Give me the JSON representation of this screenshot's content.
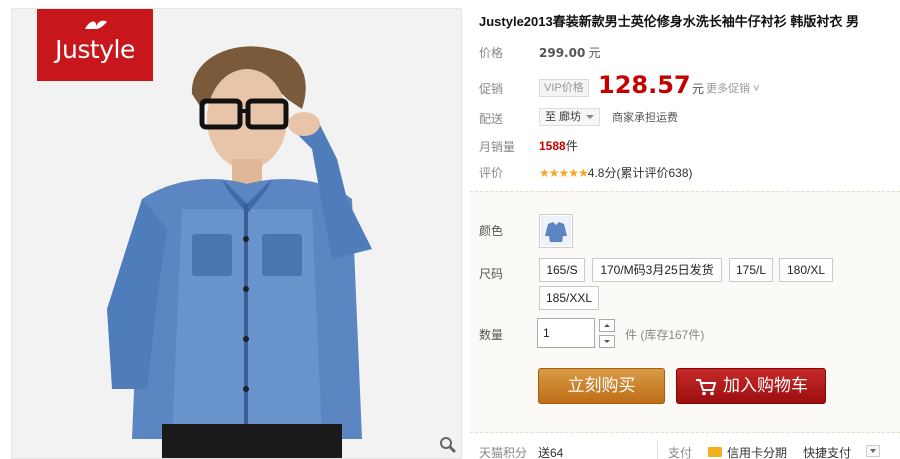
{
  "gallery": {
    "brand_text": "Justyle"
  },
  "product": {
    "title": "Justyle2013春装新款男士英伦修身水洗长袖牛仔衬衫 韩版衬衣 男"
  },
  "price": {
    "label": "价格",
    "original": "299.00",
    "currency": "元"
  },
  "promo": {
    "label": "促销",
    "vip_tag": "VIP价格",
    "price": "128.57",
    "currency": "元",
    "more": "更多促销"
  },
  "delivery": {
    "label": "配送",
    "location": "至 廊坊",
    "shipping": "商家承担运费"
  },
  "sales": {
    "label": "月销量",
    "count": "1588",
    "unit": "件"
  },
  "rating": {
    "label": "评价",
    "stars": "★★★★★",
    "text": "4.8分(累计评价638)"
  },
  "options": {
    "color_label": "颜色",
    "size_label": "尺码",
    "sizes": [
      "165/S",
      "170/M码3月25日发货",
      "175/L",
      "180/XL",
      "185/XXL"
    ],
    "qty_label": "数量",
    "qty_value": "1",
    "stock": "件 (库存167件)"
  },
  "actions": {
    "buy": "立刻购买",
    "add_to_cart": "加入购物车"
  },
  "footer": {
    "points_label": "天猫积分",
    "points_value": "送64",
    "pay_label": "支付",
    "credit_card": "信用卡分期",
    "quick_pay": "快捷支付"
  },
  "colors": {
    "price_red": "#c40000",
    "buy_orange": "#c97a26",
    "cart_red": "#b01818",
    "brand_red": "#c8161d"
  }
}
